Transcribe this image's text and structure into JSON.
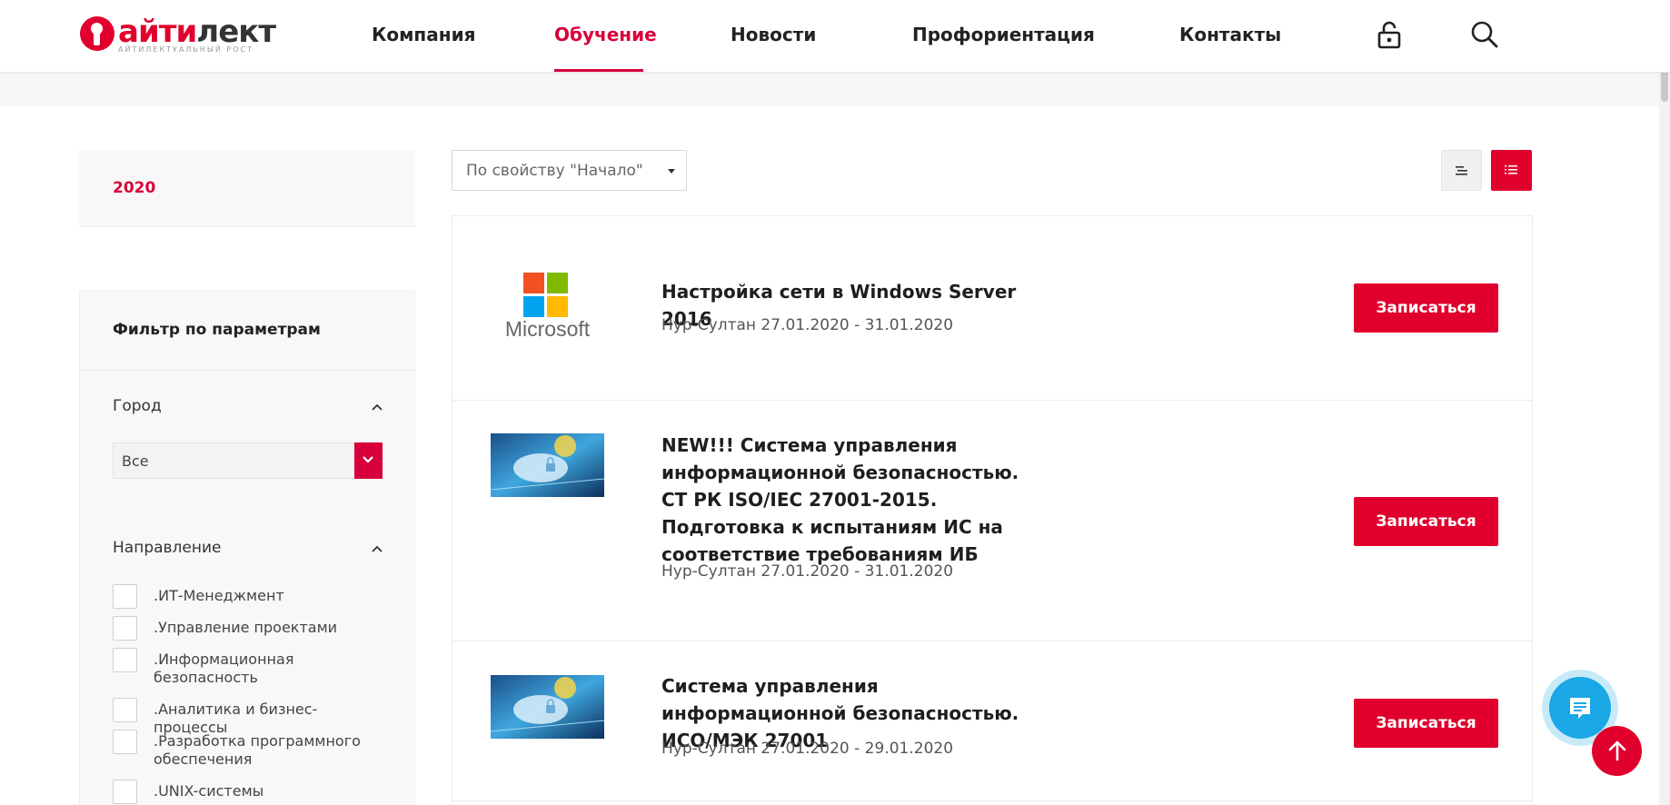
{
  "header": {
    "logo_word_a": "айти",
    "logo_word_b": "лект",
    "logo_tagline": "айтилектуальный рост",
    "nav": [
      {
        "label": "Компания"
      },
      {
        "label": "Обучение"
      },
      {
        "label": "Новости"
      },
      {
        "label": "Профориентация"
      },
      {
        "label": "Контакты"
      }
    ],
    "active_nav": "Обучение"
  },
  "sidebar": {
    "year": "2020",
    "filter_title": "Фильтр по параметрам",
    "city": {
      "title": "Город",
      "selected": "Все"
    },
    "direction": {
      "title": "Направление",
      "options": [
        ".ИТ-Менеджмент",
        ".Управление проектами",
        ".Информационная безопасность",
        ".Аналитика и бизнес-процессы",
        ".Разработка программного обеспечения",
        ".UNIX-системы"
      ]
    }
  },
  "toolbar": {
    "sort_value": "По свойству \"Начало\""
  },
  "courses": [
    {
      "title": "Настройка сети в Windows Server 2016",
      "meta": "Нур-Султан 27.01.2020 - 31.01.2020",
      "thumb_text": "Microsoft",
      "button": "Записаться"
    },
    {
      "title": "NEW!!! Система управления информационной безопасностью. СТ РК ISO/IEC 27001-2015. Подготовка к испытаниям ИС на соответствие требованиям ИБ",
      "meta": "Нур-Султан 27.01.2020 - 31.01.2020",
      "button": "Записаться"
    },
    {
      "title": "Система управления информационной безопасностью. ИСО/МЭК 27001",
      "meta": "Нур-Султан 27.01.2020 - 29.01.2020",
      "button": "Записаться"
    }
  ],
  "colors": {
    "brand_red": "#e1002d",
    "chat_blue": "#1aa7e6"
  }
}
